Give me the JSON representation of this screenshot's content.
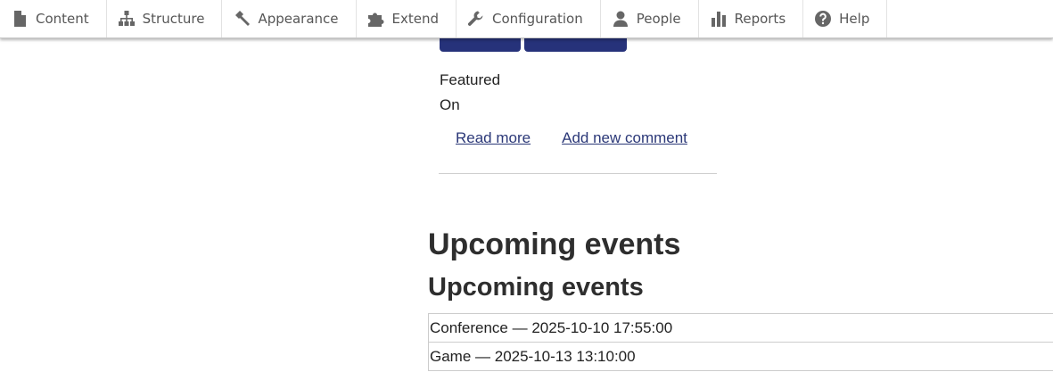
{
  "toolbar": {
    "items": [
      {
        "label": "Content",
        "icon": "file-icon"
      },
      {
        "label": "Structure",
        "icon": "sitemap-icon"
      },
      {
        "label": "Appearance",
        "icon": "brush-icon"
      },
      {
        "label": "Extend",
        "icon": "puzzle-icon"
      },
      {
        "label": "Configuration",
        "icon": "wrench-icon"
      },
      {
        "label": "People",
        "icon": "person-icon"
      },
      {
        "label": "Reports",
        "icon": "bar-chart-icon"
      },
      {
        "label": "Help",
        "icon": "question-circle-icon"
      }
    ]
  },
  "article": {
    "field_label": "Featured",
    "field_value": "On",
    "links": {
      "read_more": "Read more",
      "add_comment": "Add new comment"
    }
  },
  "events": {
    "heading_large": "Upcoming events",
    "heading_medium": "Upcoming events",
    "items": [
      "Conference — 2025-10-10 17:55:00",
      "Game — 2025-10-13 13:10:00"
    ]
  },
  "colors": {
    "button": "#26327a",
    "link": "#2b3878",
    "heading": "#2e2e2e",
    "toolbar_text": "#565656"
  }
}
